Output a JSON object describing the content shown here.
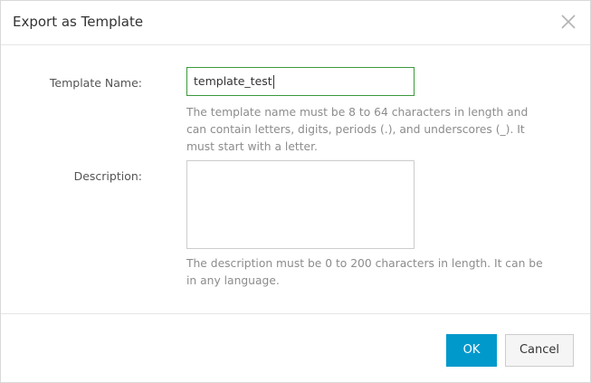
{
  "dialog": {
    "title": "Export as Template",
    "close_icon": "close-icon"
  },
  "form": {
    "template_name": {
      "label": "Template Name:",
      "value": "template_test",
      "hint": "The template name must be 8 to 64 characters in length and can contain letters, digits, periods (.), and underscores (_). It must start with a letter."
    },
    "description": {
      "label": "Description:",
      "value": "",
      "hint": "The description must be 0 to 200 characters in length. It can be in any language."
    }
  },
  "footer": {
    "ok_label": "OK",
    "cancel_label": "Cancel"
  },
  "colors": {
    "primary_button": "#0099cc",
    "focused_input_border": "#3c9a3c",
    "hint_text": "#8c8c8c"
  }
}
